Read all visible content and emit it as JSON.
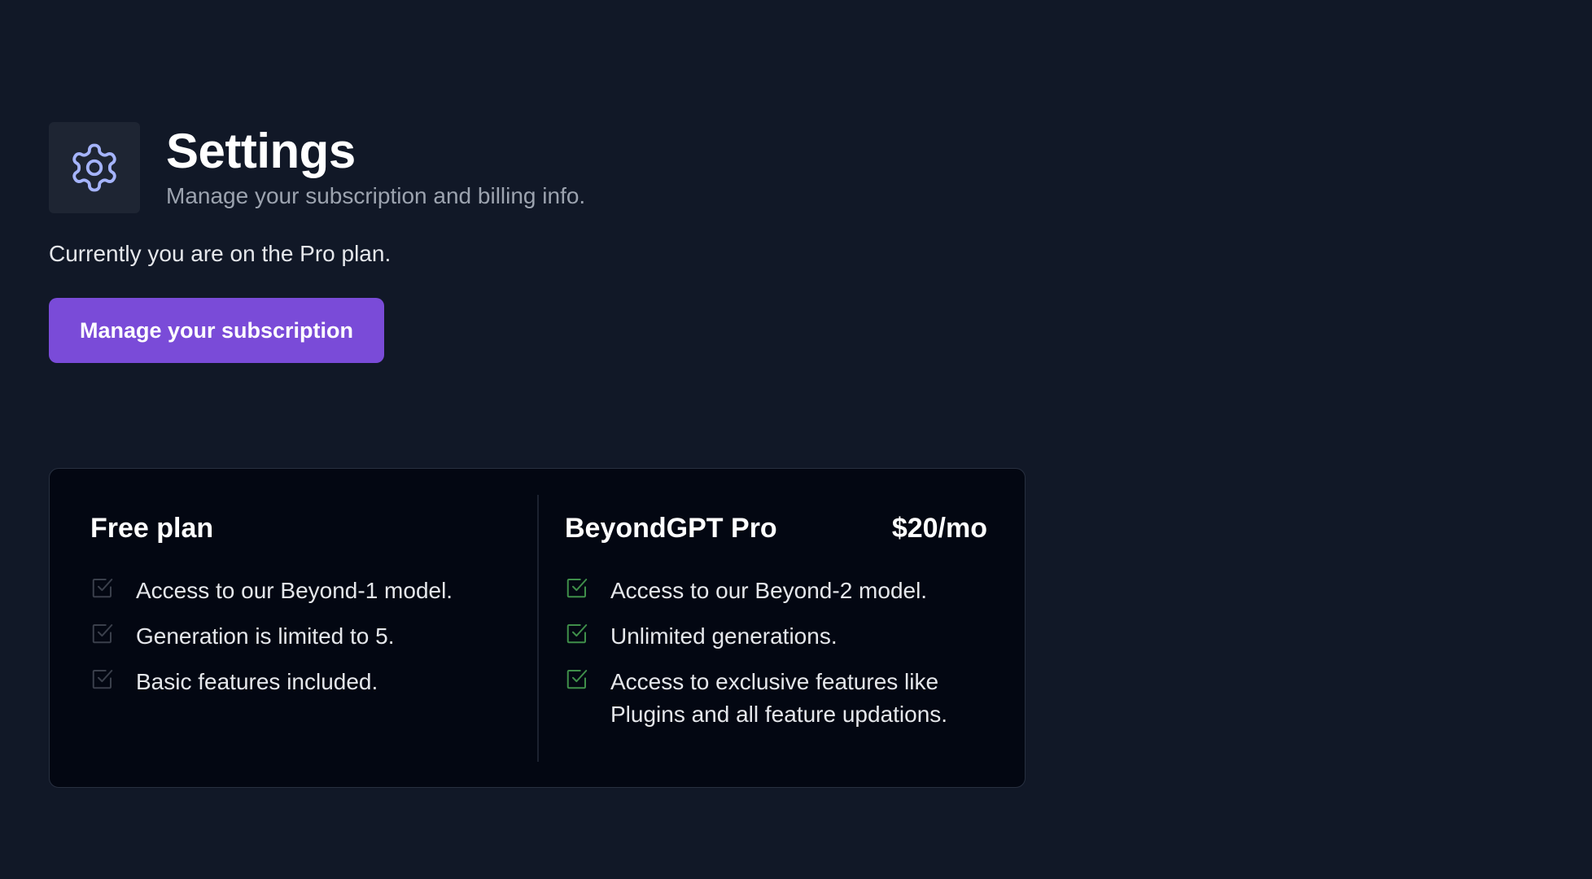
{
  "header": {
    "icon": "gear-icon",
    "title": "Settings",
    "subtitle": "Manage your subscription and billing info."
  },
  "current_plan_text": "Currently you are on the Pro plan.",
  "manage_button_label": "Manage your subscription",
  "plans": {
    "free": {
      "name": "Free plan",
      "features": [
        "Access to our Beyond-1 model.",
        "Generation is limited to 5.",
        "Basic features included."
      ],
      "check_color": "#3a3f4b"
    },
    "pro": {
      "name": "BeyondGPT Pro",
      "price": "$20/mo",
      "features": [
        "Access to our Beyond-2 model.",
        "Unlimited generations.",
        "Access to exclusive features like Plugins and all feature updations."
      ],
      "check_color": "#3f8f4a"
    }
  },
  "colors": {
    "background": "#111827",
    "card_background": "#030712",
    "accent": "#7a4bd8",
    "icon_accent": "#a5b4fc"
  }
}
